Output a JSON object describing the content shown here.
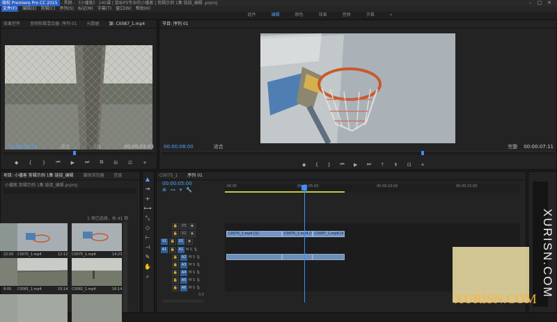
{
  "window": {
    "title_highlight": "微软 Premiere Pro CC 2015",
    "title_rest": "- 黑鹅 - 《小播客》 140课 | 鼠标PS专业的小播客 | 剪辑示例 1集 链接_编辑 .prproj",
    "controls": [
      "–",
      "□",
      "✕"
    ]
  },
  "menu": [
    "文件(F)",
    "编辑(E)",
    "剪辑(C)",
    "序列(S)",
    "标记(M)",
    "字幕(T)",
    "窗口(W)",
    "帮助(H)"
  ],
  "workspaces": {
    "items": [
      "组件",
      "编辑",
      "颜色",
      "效果",
      "音频",
      "字幕"
    ],
    "active_index": 1,
    "more": "»"
  },
  "source": {
    "tabs": [
      "效果控件",
      "音频剪辑混合器: 序列 01",
      "元数据",
      "源: C0087_1.mp4"
    ],
    "active_tab": 3,
    "timecode": "10:40:53:16",
    "fit": "适合",
    "resolution": "1/1",
    "duration": "00:00:02:03"
  },
  "program": {
    "tab": "节目: 序列 01",
    "timecode": "00:00:08:00",
    "fit": "适合",
    "resolution": "完整",
    "duration": "00:00:07:11"
  },
  "project": {
    "tabs": [
      "项目: 小播客 剪辑示例 1集 链接_编辑",
      "媒体浏览器",
      "信息"
    ],
    "path": "小播客 剪辑示例 1集 链接_编辑.prproj",
    "selection": "1 项已选择，共 41 项",
    "items": [
      {
        "name": "C0075_1.mp4",
        "dur": "22:05"
      },
      {
        "name": "C0075_1.mp4",
        "dur": "12:12"
      },
      {
        "name": "C0076_1.mp4",
        "dur": "14:23"
      },
      {
        "name": "C0081_1.mp4",
        "dur": "8:05"
      },
      {
        "name": "C0082_1.mp4",
        "dur": "15:14"
      },
      {
        "name": "C0083_1.mp4",
        "dur": "16:14"
      }
    ]
  },
  "timeline": {
    "tabs": [
      "C0075_1",
      "序列 01"
    ],
    "active_tab": 1,
    "timecode": "00:00:05:00",
    "ruler": [
      ":00:00",
      "00:00:05:00",
      "00:00:10:00",
      "00:00:15:00"
    ],
    "video_tracks": [
      "V3",
      "V2",
      "V1"
    ],
    "audio_tracks": [
      "A1",
      "A2",
      "A3",
      "A4",
      "A5",
      "A6"
    ],
    "src_video": "V1",
    "src_audio": "A1",
    "clips": [
      "C0075_1.mp4 [V]",
      "C0075_1.mp4 [V]",
      "C0087_1.mp4 [V]"
    ],
    "zoom": "0.0"
  },
  "watermark": {
    "vertical": "XURISN.COM",
    "horizontal": "XURISN.COM"
  }
}
